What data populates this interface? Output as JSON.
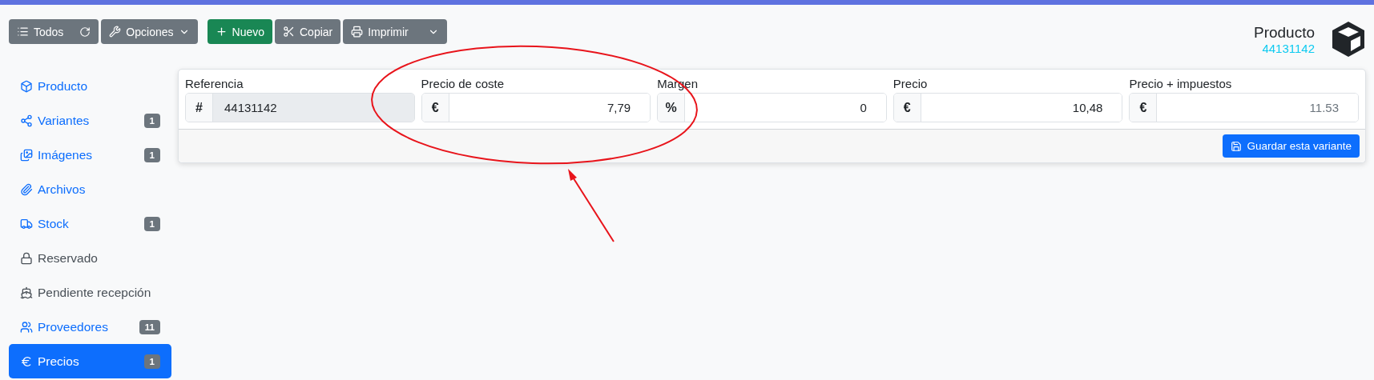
{
  "toolbar": {
    "groups": [
      [
        {
          "label": "Todos",
          "kind": "list",
          "refresh": true
        },
        {
          "label": "Opciones",
          "kind": "wrench",
          "caret": true
        }
      ],
      [
        {
          "label": "Nuevo",
          "kind": "plus"
        },
        {
          "label": "Copiar",
          "kind": "scissors"
        },
        {
          "label": "Imprimir",
          "kind": "printer",
          "split": true
        }
      ]
    ]
  },
  "header": {
    "title": "Producto",
    "reference": "44131142"
  },
  "sidebar": {
    "items": [
      {
        "label": "Producto",
        "kind": "box",
        "disabled": false,
        "selected": false
      },
      {
        "label": "Variantes",
        "kind": "variants",
        "badge": "1",
        "disabled": false,
        "selected": false
      },
      {
        "label": "Imágenes",
        "kind": "images",
        "badge": "1",
        "disabled": false,
        "selected": false
      },
      {
        "label": "Archivos",
        "kind": "paperclip",
        "disabled": false,
        "selected": false
      },
      {
        "label": "Stock",
        "kind": "dolly",
        "badge": "1",
        "disabled": false,
        "selected": false
      },
      {
        "label": "Reservado",
        "kind": "lock",
        "disabled": true,
        "selected": false
      },
      {
        "label": "Pendiente recepción",
        "kind": "ship",
        "disabled": true,
        "selected": false
      },
      {
        "label": "Proveedores",
        "kind": "users",
        "badge": "11",
        "disabled": false,
        "selected": false
      },
      {
        "label": "Precios",
        "kind": "euro",
        "badge": "1",
        "disabled": false,
        "selected": true
      }
    ]
  },
  "form": {
    "fields": [
      {
        "label": "Referencia",
        "addon": "#",
        "value": "44131142",
        "readonly": true,
        "muted": false
      },
      {
        "label": "Precio de coste",
        "addon": "€",
        "value": "7,79",
        "readonly": false,
        "muted": false
      },
      {
        "label": "Margen",
        "addon": "%",
        "value": "0",
        "readonly": false,
        "muted": false
      },
      {
        "label": "Precio",
        "addon": "€",
        "value": "10,48",
        "readonly": false,
        "muted": false
      },
      {
        "label": "Precio + impuestos",
        "addon": "€",
        "value": "11.53",
        "readonly": false,
        "muted": true
      }
    ],
    "save_button": "Guardar esta variante"
  }
}
